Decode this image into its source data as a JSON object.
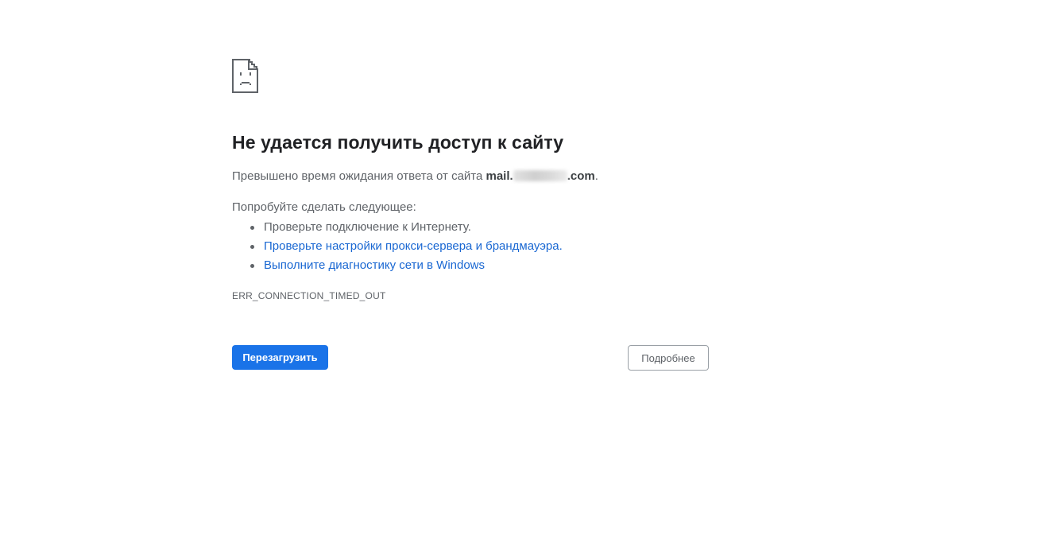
{
  "icon": "sad-page-icon",
  "title": "Не удается получить доступ к сайту",
  "summary": {
    "prefix": "Превышено время ожидания ответа от сайта ",
    "host_start": "mail.",
    "host_end": ".com",
    "suffix": "."
  },
  "suggestions_heading": "Попробуйте сделать следующее:",
  "suggestions": [
    {
      "label": "Проверьте подключение к Интернету.",
      "type": "text"
    },
    {
      "label": "Проверьте настройки прокси-сервера и брандмауэра.",
      "type": "link"
    },
    {
      "label": "Выполните диагностику сети в Windows",
      "type": "link"
    }
  ],
  "error_code": "ERR_CONNECTION_TIMED_OUT",
  "buttons": {
    "reload": "Перезагрузить",
    "details": "Подробнее"
  },
  "colors": {
    "primary": "#1a73e8",
    "link": "#1967d2",
    "title": "#202124",
    "text": "#5f6368"
  }
}
